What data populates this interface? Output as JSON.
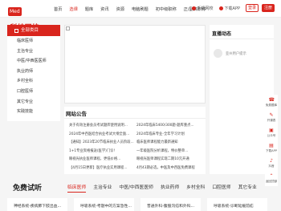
{
  "brand": {
    "logo_box": "Med",
    "logo_text": "科技网校"
  },
  "nav": {
    "items": [
      {
        "label": "首页",
        "active": false
      },
      {
        "label": "选课",
        "active": true
      },
      {
        "label": "题库",
        "active": false
      },
      {
        "label": "资讯",
        "active": false
      },
      {
        "label": "资源",
        "active": false
      },
      {
        "label": "电脑刷题",
        "active": false
      },
      {
        "label": "初中级职称",
        "active": false
      },
      {
        "label": "正/副高职称",
        "active": false
      }
    ]
  },
  "top_right": {
    "mobile": "手机网校",
    "app": "下载APP",
    "login": "登录",
    "register": "注册"
  },
  "sidebar": {
    "title": "全部类目",
    "items": [
      "临床医师",
      "主治专业",
      "中医/中西医医师",
      "执业药师",
      "乡村全科",
      "口腔医师",
      "其它专业",
      "实践技能"
    ]
  },
  "notice": {
    "title": "网站公告",
    "items": [
      "关于有效注册会员考试题库使用说明...",
      "2024年中西医结合执业考试大纲全面...",
      "【通知】2023年20节临床执业人员阶段...",
      "1+1专业资格报送(医学)门诊!",
      "眼视光执业医师课程，更低价格...",
      "【4月15日更新】医疗执业实用课程...",
      "2024年临床5400/300题-题库重点...",
      "2024年临床专业-全年学习计划",
      "临床医师课程能力最新通知",
      "一年级医院分析课程，特价整单...",
      "眼视光医师课程实现二期10元开通",
      "4月43期必选，中医及中西医免费课程"
    ]
  },
  "live": {
    "title": "直播动态",
    "user": "亚州用户提示"
  },
  "float_bar": {
    "items": [
      {
        "icon": "hotline-icon",
        "glyph": "☎",
        "label": "免费题库"
      },
      {
        "icon": "document-icon",
        "glyph": "✎",
        "label": "开课表"
      },
      {
        "icon": "mobile-icon",
        "glyph": "▣",
        "label": "公众号"
      },
      {
        "icon": "app-icon",
        "glyph": "▤",
        "label": "下载APP"
      },
      {
        "icon": "tiktok-icon",
        "glyph": "♪",
        "label": "抖音"
      },
      {
        "icon": "top-icon",
        "glyph": "⌃",
        "label": "返回顶部"
      }
    ]
  },
  "courses": {
    "title": "免费试听",
    "tabs": [
      {
        "label": "临床医师",
        "active": true
      },
      {
        "label": "主治专业",
        "active": false
      },
      {
        "label": "中医/中西医医师",
        "active": false
      },
      {
        "label": "执业药师",
        "active": false
      },
      {
        "label": "乡村全科",
        "active": false
      },
      {
        "label": "口腔医师",
        "active": false
      },
      {
        "label": "其它专业",
        "active": false
      }
    ],
    "cards": [
      "神经系统-疾病肺下肢出血...",
      "呼吸系统-考题中的方案急性...",
      "普通外科-腹股沟疝和外科...",
      "呼吸系统-诊断延缓前疝"
    ]
  },
  "colors": {
    "accent": "#d9251d"
  }
}
